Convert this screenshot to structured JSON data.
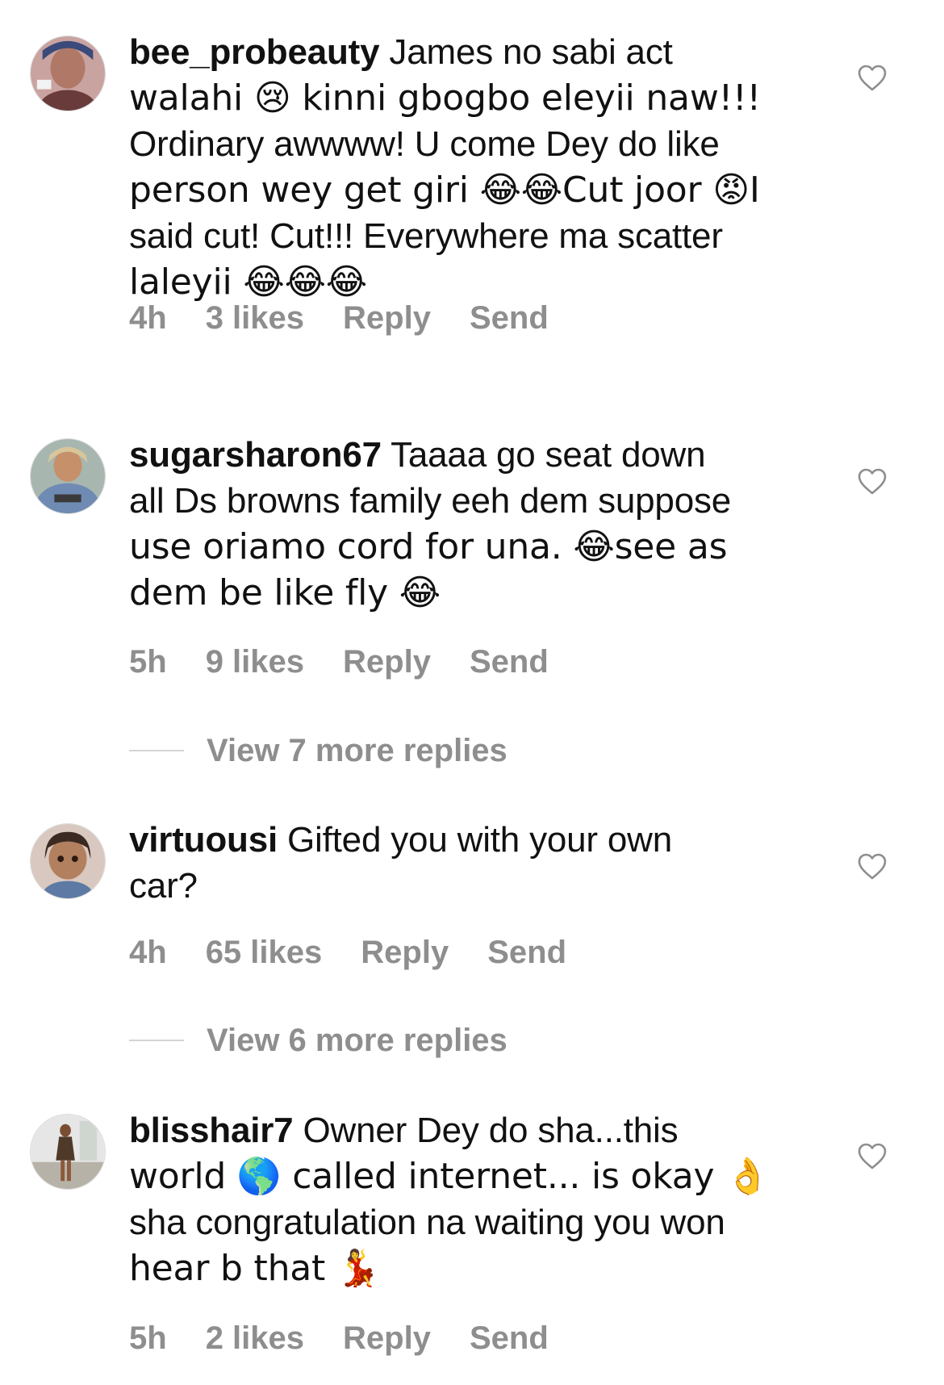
{
  "comments": [
    {
      "username": "bee_probeauty",
      "lines": [
        "James no sabi act",
        "walahi 😢  kinni gbogbo eleyii naw!!!",
        "Ordinary awwww! U come Dey do like",
        "person wey get giri 😂😂Cut joor 😡I",
        "said cut! Cut!!! Everywhere ma scatter",
        "laleyii 😂😂😂"
      ],
      "time": "4h",
      "likes": "3 likes",
      "reply": "Reply",
      "send": "Send"
    },
    {
      "username": "sugarsharon67",
      "lines": [
        "Taaaa go seat down",
        "all Ds browns family eeh dem suppose",
        "use oriamo cord for una. 😂see as",
        "dem be like fly 😂"
      ],
      "time": "5h",
      "likes": "9 likes",
      "reply": "Reply",
      "send": "Send",
      "view_more": "View 7 more replies"
    },
    {
      "username": "virtuousi",
      "lines": [
        "Gifted you with your own",
        "car?"
      ],
      "time": "4h",
      "likes": "65 likes",
      "reply": "Reply",
      "send": "Send",
      "view_more": "View 6 more replies"
    },
    {
      "username": "blisshair7",
      "lines": [
        "Owner Dey do sha...this",
        "world 🌎 called internet... is okay 👌",
        "sha congratulation na waiting you won",
        "hear b that 💃"
      ],
      "time": "5h",
      "likes": "2 likes",
      "reply": "Reply",
      "send": "Send"
    }
  ],
  "colors": {
    "text": "#111111",
    "muted": "#8e8e8e",
    "divider": "#d4d4d4",
    "heart_outline": "#8e8e8e"
  },
  "icons": {
    "like": "heart-outline-icon"
  }
}
